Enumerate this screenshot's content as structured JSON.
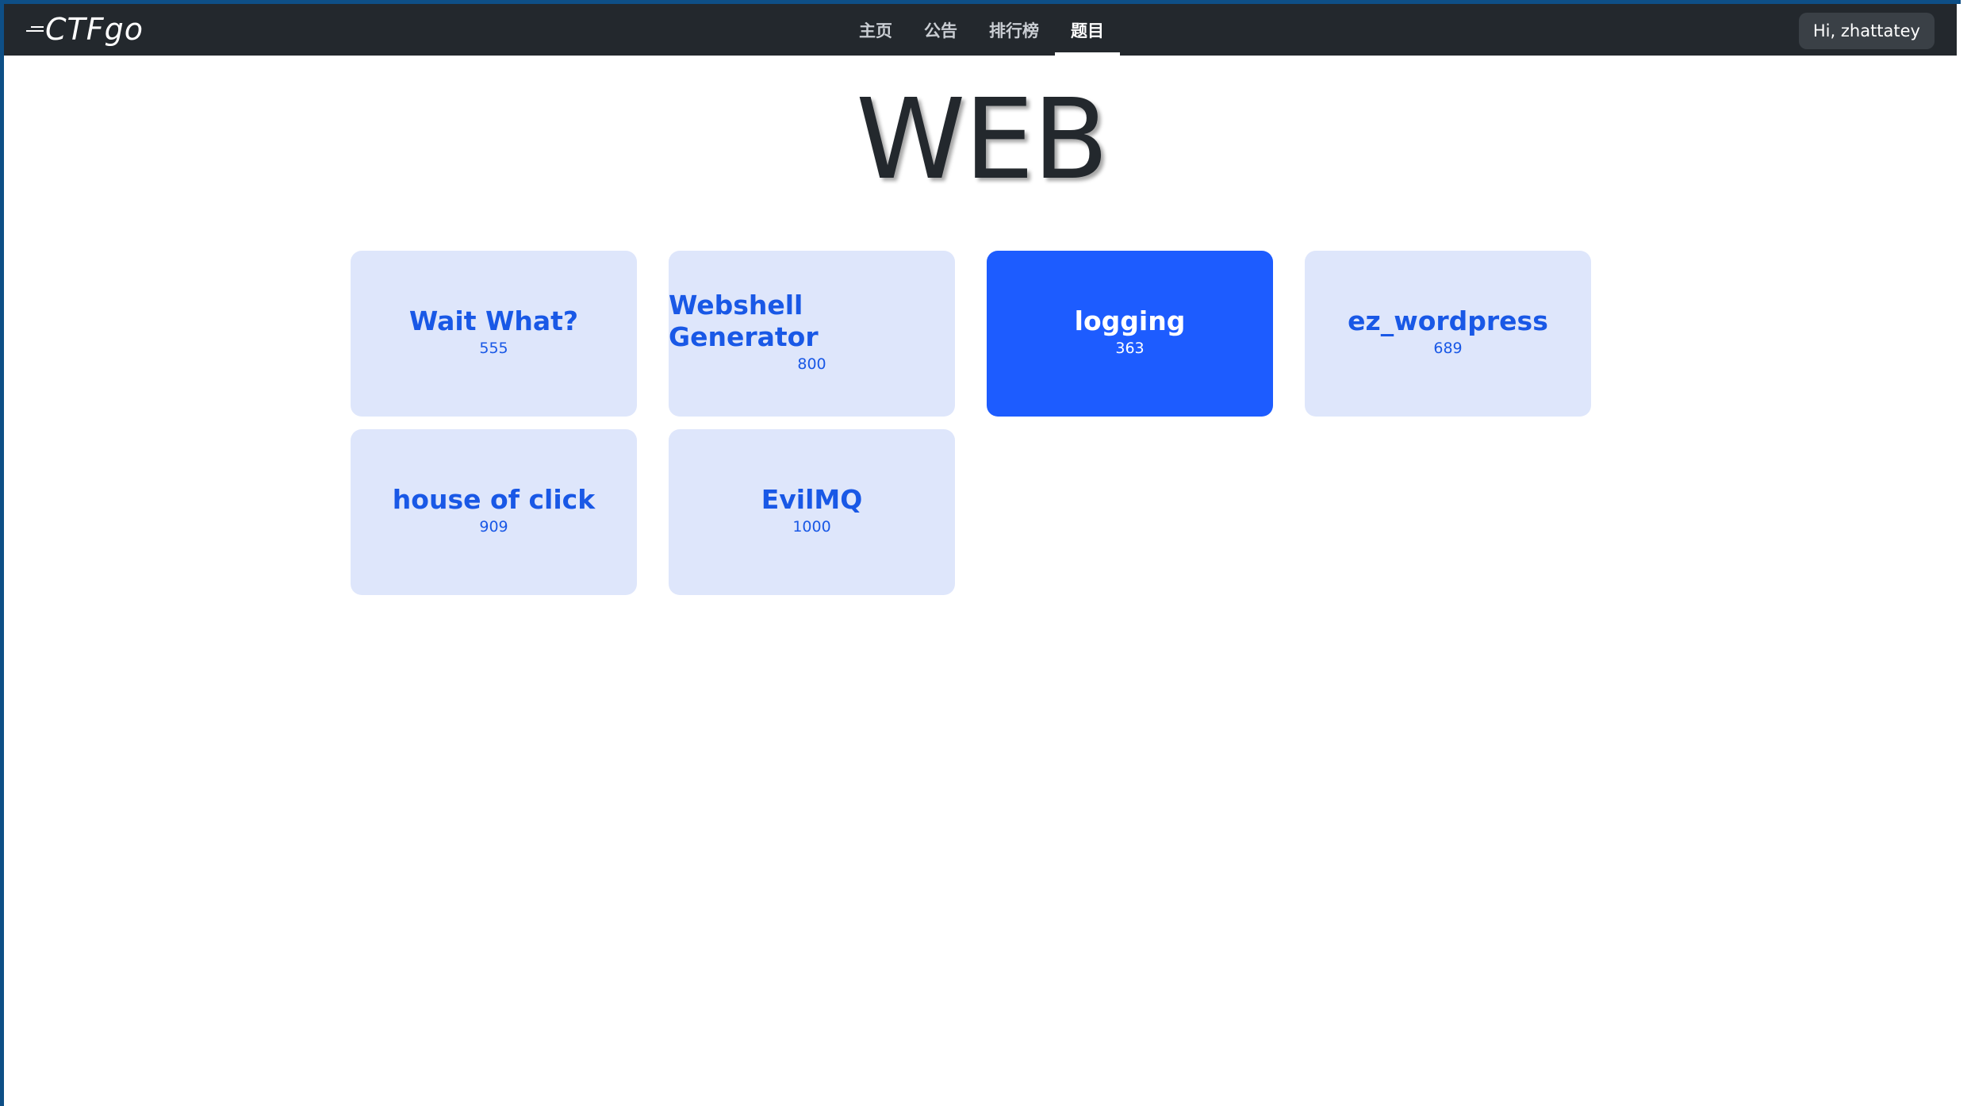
{
  "navbar": {
    "brand": "CTFgo",
    "links": [
      {
        "label": "主页",
        "active": false
      },
      {
        "label": "公告",
        "active": false
      },
      {
        "label": "排行榜",
        "active": false
      },
      {
        "label": "题目",
        "active": true
      }
    ],
    "user_greeting": "Hi, zhattatey"
  },
  "page": {
    "title": "WEB"
  },
  "challenges": [
    {
      "name": "Wait What?",
      "score": "555",
      "selected": false
    },
    {
      "name": "Webshell Generator",
      "score": "800",
      "selected": false
    },
    {
      "name": "logging",
      "score": "363",
      "selected": true
    },
    {
      "name": "ez_wordpress",
      "score": "689",
      "selected": false
    },
    {
      "name": "house of click",
      "score": "909",
      "selected": false
    },
    {
      "name": "EvilMQ",
      "score": "1000",
      "selected": false
    }
  ],
  "colors": {
    "navbar_bg": "#23282d",
    "card_bg": "#dee6fb",
    "card_text": "#1958e6",
    "card_selected_bg": "#1d5cff",
    "window_border": "#0e4f86"
  }
}
